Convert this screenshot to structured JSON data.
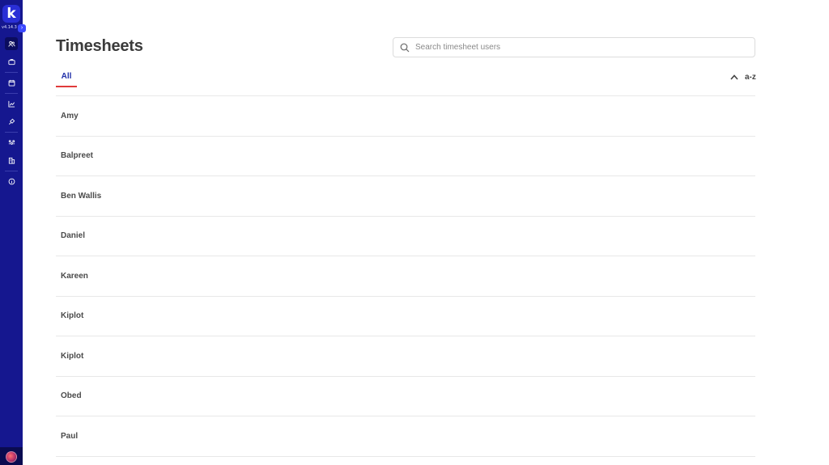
{
  "app": {
    "logo_letter": "k",
    "version": "v4.14.3"
  },
  "sidebar": {
    "items": [
      {
        "icon": "users-icon",
        "active": true
      },
      {
        "icon": "briefcase-icon",
        "active": false
      },
      {
        "icon": "calendar-icon",
        "active": false
      },
      {
        "icon": "chart-icon",
        "active": false
      },
      {
        "icon": "plug-icon",
        "active": false
      },
      {
        "icon": "team-icon",
        "active": false
      },
      {
        "icon": "building-icon",
        "active": false
      },
      {
        "icon": "info-icon",
        "active": false
      }
    ]
  },
  "header": {
    "title": "Timesheets"
  },
  "search": {
    "placeholder": "Search timesheet users",
    "value": ""
  },
  "tabs": [
    {
      "label": "All",
      "active": true
    }
  ],
  "sort": {
    "label": "a-z",
    "direction": "ascending"
  },
  "users": [
    "Amy",
    "Balpreet",
    "Ben Wallis",
    "Daniel",
    "Kareen",
    "Kiplot",
    "Kiplot",
    "Obed",
    "Paul"
  ],
  "colors": {
    "sidebar": "#15178f",
    "accent": "#1f2ea8",
    "tab_underline": "#e03b3b"
  }
}
